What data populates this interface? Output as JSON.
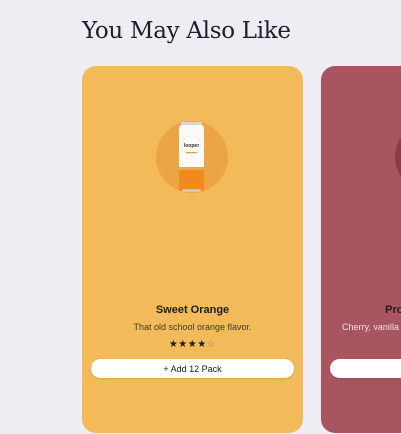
{
  "section": {
    "title": "You May Also Like"
  },
  "products": [
    {
      "name": "Sweet Orange",
      "description": "That old school orange flavor.",
      "rating": 4,
      "rating_max": 5,
      "button_label": "+ Add 12 Pack",
      "card_color": "#f2ba58",
      "can_brand": "looper"
    },
    {
      "name": "Pro",
      "description": "Cherry, vanilla",
      "card_color": "#a8555f"
    }
  ]
}
